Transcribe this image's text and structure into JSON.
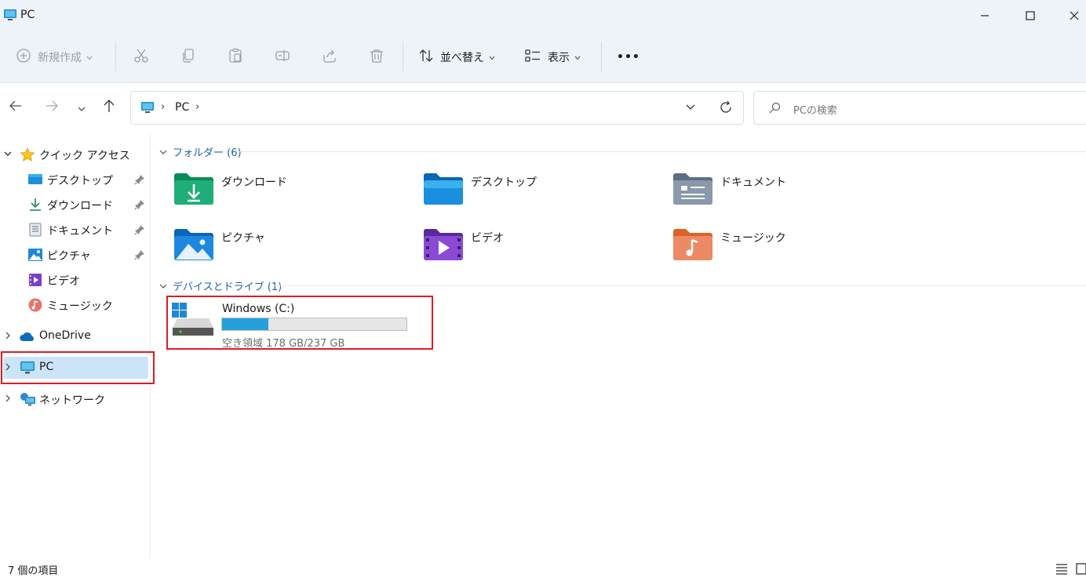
{
  "window": {
    "title": "PC"
  },
  "toolbar": {
    "new_label": "新規作成",
    "sort_label": "並べ替え",
    "view_label": "表示",
    "more_label": "•••"
  },
  "address": {
    "crumb": "PC",
    "search_placeholder": "PCの検索"
  },
  "sidebar": {
    "quick_access": "クイック アクセス",
    "quick_items": [
      {
        "label": "デスクトップ"
      },
      {
        "label": "ダウンロード"
      },
      {
        "label": "ドキュメント"
      },
      {
        "label": "ピクチャ"
      },
      {
        "label": "ビデオ"
      },
      {
        "label": "ミュージック"
      }
    ],
    "onedrive": "OneDrive",
    "pc": "PC",
    "network": "ネットワーク"
  },
  "content": {
    "folders_header": "フォルダー (6)",
    "folders": [
      {
        "name": "ダウンロード"
      },
      {
        "name": "デスクトップ"
      },
      {
        "name": "ドキュメント"
      },
      {
        "name": "ピクチャ"
      },
      {
        "name": "ビデオ"
      },
      {
        "name": "ミュージック"
      }
    ],
    "drives_header": "デバイスとドライブ (1)",
    "drive": {
      "name": "Windows (C:)",
      "free_text": "空き領域 178 GB/237 GB",
      "free_gb": 178,
      "total_gb": 237
    }
  },
  "status": {
    "item_count": "7 個の項目"
  },
  "colors": {
    "accent": "#26a0da",
    "highlight_box": "#e01b24",
    "selection": "#cce4f7",
    "group_header": "#1f5fa8"
  }
}
